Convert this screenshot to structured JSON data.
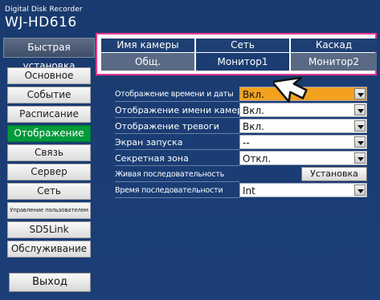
{
  "device": {
    "subtitle": "Digital Disk Recorder",
    "model": "WJ-HD616"
  },
  "sidebar": {
    "quick_setup": "Быстрая установка",
    "items": [
      {
        "label": "Основное",
        "active": false
      },
      {
        "label": "Событие",
        "active": false
      },
      {
        "label": "Расписание",
        "active": false
      },
      {
        "label": "Отображение",
        "active": true
      },
      {
        "label": "Связь",
        "active": false
      },
      {
        "label": "Сервер",
        "active": false
      },
      {
        "label": "Сеть",
        "active": false
      },
      {
        "label": "Управление пользователем",
        "active": false
      },
      {
        "label": "SD5Link",
        "active": false
      },
      {
        "label": "Обслуживание",
        "active": false
      }
    ],
    "exit": "Выход"
  },
  "tabs": {
    "row1": [
      "Имя камеры",
      "Сеть",
      "Каскад"
    ],
    "row2": [
      "Общ.",
      "Монитор1",
      "Монитор2"
    ],
    "active": "Монитор1"
  },
  "settings": [
    {
      "label": "Отображение времени и даты",
      "value": "Вкл."
    },
    {
      "label": "Отображение имени камеры",
      "value": "Вкл."
    },
    {
      "label": "Отображение тревоги",
      "value": "Вкл."
    },
    {
      "label": "Экран запуска",
      "value": "--"
    },
    {
      "label": "Секретная зона",
      "value": "Откл."
    },
    {
      "label": "Живая последовательность",
      "button": "Установка"
    },
    {
      "label": "Время последовательности",
      "value": "Int"
    }
  ],
  "colors": {
    "background": "#1a3c72",
    "active_menu": "#009a3a",
    "highlight_value": "#f3a11f",
    "tab_outline": "#e4388f"
  },
  "icons": {
    "pointer": "mouse-cursor-icon",
    "dropdown": "dropdown-arrow-icon"
  }
}
